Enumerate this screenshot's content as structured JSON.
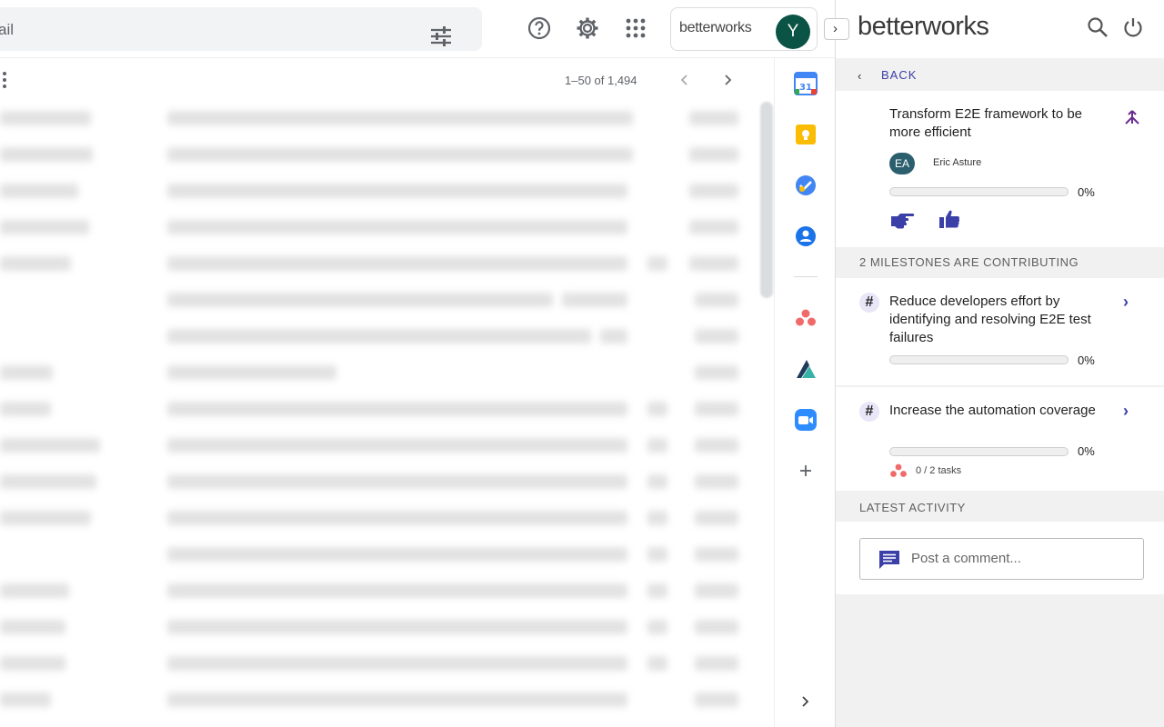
{
  "gmail": {
    "search_placeholder": "ail",
    "pagination": "1–50 of 1,494",
    "bw_chip_logo": "betterworks",
    "avatar_initial": "Y"
  },
  "panel": {
    "logo": "betterworks",
    "back_label": "BACK",
    "goal": {
      "title": "Transform E2E framework to be more efficient",
      "owner_initials": "EA",
      "owner_name": "Eric Asture",
      "progress_pct": 0,
      "progress_label": "0%"
    },
    "milestones_header": "2 MILESTONES ARE CONTRIBUTING",
    "milestones": [
      {
        "title": "Reduce developers effort by identifying and resolving E2E test failures",
        "progress_pct": 0,
        "progress_label": "0%"
      },
      {
        "title": "Increase the automation coverage",
        "progress_pct": 0,
        "progress_label": "0%",
        "tasks": "0 / 2 tasks"
      }
    ],
    "activity_header": "LATEST ACTIVITY",
    "comment_placeholder": "Post a comment..."
  },
  "colors": {
    "accent": "#3b3fa8",
    "teal": "#0b5345",
    "asana": "#f06a6a",
    "zoom": "#2d8cff"
  }
}
